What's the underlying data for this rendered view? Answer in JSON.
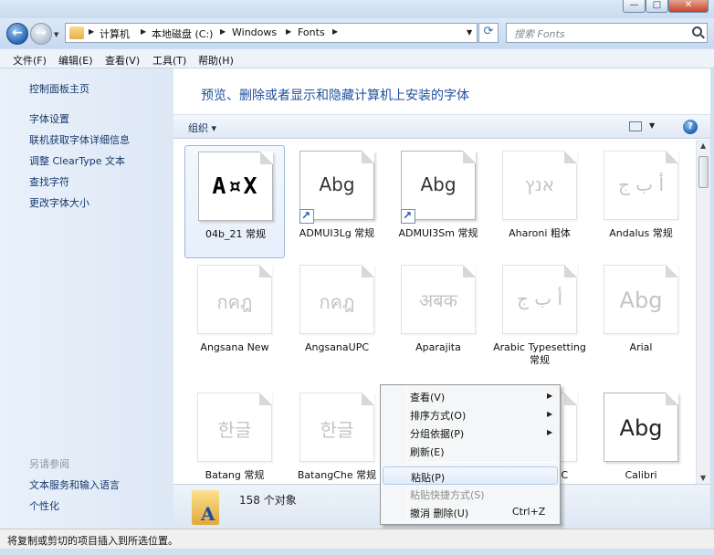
{
  "window": {
    "minimize_glyph": "—",
    "maximize_glyph": "□",
    "close_glyph": "✕"
  },
  "navigation": {
    "back_glyph": "←",
    "forward_glyph": "→",
    "history_glyph": "▼",
    "breadcrumbs": [
      "计算机",
      "本地磁盘 (C:)",
      "Windows",
      "Fonts"
    ],
    "crumb_separator": "▶",
    "dropdown_glyph": "▼",
    "refresh_glyph": "⟳",
    "search_placeholder": "搜索 Fonts"
  },
  "menubar": {
    "items": [
      "文件(F)",
      "编辑(E)",
      "查看(V)",
      "工具(T)",
      "帮助(H)"
    ]
  },
  "left_panel": {
    "control_panel_home": "控制面板主页",
    "links": [
      "字体设置",
      "联机获取字体详细信息",
      "调整 ClearType 文本",
      "查找字符",
      "更改字体大小"
    ],
    "see_also_heading": "另请参阅",
    "see_also_links": [
      "文本服务和输入语言",
      "个性化"
    ]
  },
  "main": {
    "header": "预览、删除或者显示和隐藏计算机上安装的字体",
    "organize_label": "组织 ▾",
    "view_arrow": "▼",
    "help_glyph": "?"
  },
  "fonts": [
    {
      "name": "04b_21 常规",
      "glyph": "A¤X",
      "style": "pixel",
      "faded": false,
      "shortcut": false,
      "selected": true
    },
    {
      "name": "ADMUI3Lg 常规",
      "glyph": "Abg",
      "style": "normal",
      "faded": false,
      "shortcut": true,
      "selected": false
    },
    {
      "name": "ADMUI3Sm 常规",
      "glyph": "Abg",
      "style": "normal",
      "faded": false,
      "shortcut": true,
      "selected": false
    },
    {
      "name": "Aharoni 粗体",
      "glyph": "אנץ",
      "style": "normal",
      "faded": true,
      "shortcut": false,
      "selected": false
    },
    {
      "name": "Andalus 常规",
      "glyph": "أ ب ج",
      "style": "normal",
      "faded": true,
      "shortcut": false,
      "selected": false
    },
    {
      "name": "Angsana New",
      "glyph": "กคฎ",
      "style": "normal",
      "faded": true,
      "shortcut": false,
      "selected": false
    },
    {
      "name": "AngsanaUPC",
      "glyph": "กคฎ",
      "style": "normal",
      "faded": true,
      "shortcut": false,
      "selected": false
    },
    {
      "name": "Aparajita",
      "glyph": "अबक",
      "style": "normal",
      "faded": true,
      "shortcut": false,
      "selected": false
    },
    {
      "name": "Arabic Typesetting 常规",
      "glyph": "أ ب ج",
      "style": "normal",
      "faded": true,
      "shortcut": false,
      "selected": false
    },
    {
      "name": "Arial",
      "glyph": "Abg",
      "style": "big",
      "faded": true,
      "shortcut": false,
      "selected": false
    },
    {
      "name": "Batang 常规",
      "glyph": "한글",
      "style": "normal",
      "faded": true,
      "shortcut": false,
      "selected": false
    },
    {
      "name": "BatangChe 常规",
      "glyph": "한글",
      "style": "normal",
      "faded": true,
      "shortcut": false,
      "selected": false
    },
    {
      "name": "",
      "glyph": "",
      "style": "normal",
      "faded": true,
      "shortcut": false,
      "selected": false
    },
    {
      "name": "C",
      "glyph": "",
      "style": "normal",
      "faded": true,
      "shortcut": false,
      "selected": false
    },
    {
      "name": "Calibri",
      "glyph": "Abg",
      "style": "big",
      "faded": false,
      "shortcut": false,
      "selected": false
    }
  ],
  "details": {
    "object_count": "158 个对象"
  },
  "status_bar": {
    "text": "将复制或剪切的项目插入到所选位置。"
  },
  "context_menu": {
    "items": [
      {
        "label": "查看(V)",
        "submenu": true,
        "disabled": false,
        "hover": false,
        "shortcut": ""
      },
      {
        "label": "排序方式(O)",
        "submenu": true,
        "disabled": false,
        "hover": false,
        "shortcut": ""
      },
      {
        "label": "分组依据(P)",
        "submenu": true,
        "disabled": false,
        "hover": false,
        "shortcut": ""
      },
      {
        "label": "刷新(E)",
        "submenu": false,
        "disabled": false,
        "hover": false,
        "shortcut": ""
      },
      {
        "label": "粘贴(P)",
        "submenu": false,
        "disabled": false,
        "hover": true,
        "shortcut": ""
      },
      {
        "label": "粘贴快捷方式(S)",
        "submenu": false,
        "disabled": true,
        "hover": false,
        "shortcut": ""
      },
      {
        "label": "撤消 删除(U)",
        "submenu": false,
        "disabled": false,
        "hover": false,
        "shortcut": "Ctrl+Z"
      }
    ],
    "submenu_glyph": "▶"
  }
}
